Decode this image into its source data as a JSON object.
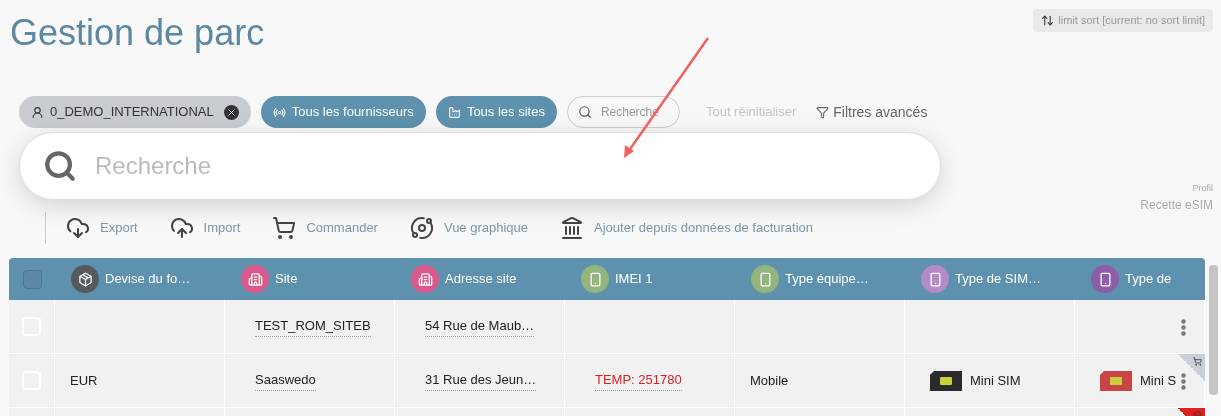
{
  "title": "Gestion de parc",
  "sort_button": "limit sort [current: no sort limit]",
  "filters": [
    {
      "kind": "account",
      "label": "0_DEMO_INTERNATIONAL"
    },
    {
      "kind": "suppliers",
      "label": "Tous les fournisseurs"
    },
    {
      "kind": "sites",
      "label": "Tous les sites"
    }
  ],
  "small_search": {
    "placeholder": "Recherche"
  },
  "reset": {
    "label": "Tout réinitialiser",
    "disabled": true
  },
  "advanced_filters": "Filtres avancés",
  "big_search": {
    "placeholder": "Recherche"
  },
  "profile": {
    "label": "Profil",
    "value": "Recette eSIM"
  },
  "toolbar": [
    {
      "kind": "export",
      "label": "Export"
    },
    {
      "kind": "import",
      "label": "Import"
    },
    {
      "kind": "cart",
      "label": "Commander"
    },
    {
      "kind": "planet",
      "label": "Vue graphique"
    },
    {
      "kind": "bank",
      "label": "Ajouter depuis données de facturation"
    }
  ],
  "table": {
    "header_checked": false,
    "columns": [
      {
        "kind": "box",
        "label": "Devise du fo…",
        "color": "#555a5e"
      },
      {
        "kind": "building",
        "label": "Site",
        "color": "#d9598a"
      },
      {
        "kind": "building",
        "label": "Adresse site",
        "color": "#d9598a"
      },
      {
        "kind": "phone",
        "label": "IMEI 1",
        "color": "#93b47c"
      },
      {
        "kind": "phone",
        "label": "Type équipe…",
        "color": "#93b47c"
      },
      {
        "kind": "sim1",
        "label": "Type de SIM…",
        "color": "#b58ac9"
      },
      {
        "kind": "sim2",
        "label": "Type de",
        "color": "#8d5ea8"
      }
    ],
    "rows": [
      {
        "checked": false,
        "kind": "plain",
        "cells": [
          {
            "kind": "plain",
            "text": ""
          },
          {
            "kind": "link",
            "text": "TEST_ROM_SITEB"
          },
          {
            "kind": "link",
            "text": "54 Rue de Maub…"
          },
          {
            "kind": "plain",
            "text": ""
          },
          {
            "kind": "plain",
            "text": ""
          },
          {
            "kind": "plain",
            "text": ""
          },
          {
            "kind": "plain",
            "text": ""
          }
        ]
      },
      {
        "checked": false,
        "kind": "cart",
        "cells": [
          {
            "kind": "plain",
            "text": "EUR"
          },
          {
            "kind": "link",
            "text": "Saaswedo"
          },
          {
            "kind": "link",
            "text": "31 Rue des Jeun…"
          },
          {
            "kind": "alert",
            "text": "TEMP: 251780"
          },
          {
            "kind": "plain",
            "text": "Mobile"
          },
          {
            "kind": "sim",
            "text": "Mini SIM",
            "color": "#2b2b2b"
          },
          {
            "kind": "sim",
            "text": "Mini S",
            "color": "#c94545"
          }
        ]
      },
      {
        "kind": "layers",
        "cells": []
      }
    ]
  }
}
